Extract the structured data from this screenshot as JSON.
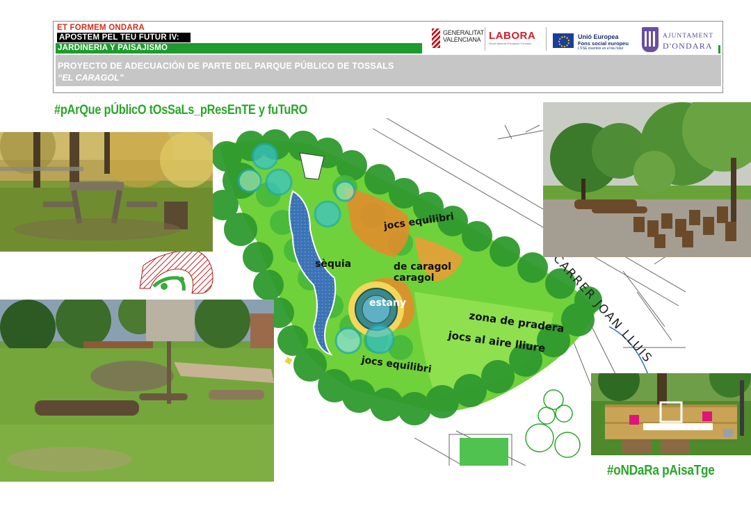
{
  "header": {
    "line1": "ET FORMEM ONDARA",
    "line2": "APOSTEM PEL TEU FUTUR IV:",
    "line3": "JARDINERIA Y PAISAJISMO",
    "project": "PROYECTO DE ADECUACIÓN DE PARTE DEL PARQUE PÚBLICO DE TOSSALS",
    "subtitle": "“EL CARAGOL”"
  },
  "logos": {
    "generalitat_line1": "GENERALITAT",
    "generalitat_line2": "VALENCIANA",
    "labora": "LABORA",
    "labora_sub": "Servei Valencià d'Ocupació i Formació",
    "eu_line1": "Unió Europea",
    "eu_line2": "Fons social europeu",
    "eu_line3": "L'FSE inverteix en el teu futur",
    "ajuntament_line1": "AJUNTAMENT",
    "ajuntament_line2": "D'ONDARA"
  },
  "hashtags": {
    "top": "#pArQue pÚblicO tOsSaLs_pResEnTE  y fuTuRO",
    "bottom": "#oNDaRa pAisaTge"
  },
  "plan": {
    "labels": {
      "jocs_top": "jocs equilibri",
      "sequia": "sèquia",
      "caragol_1": "de caragol",
      "caragol_2": "caragol",
      "estany": "estany",
      "zona_pradera": "zona de pradera",
      "jocs_aire": "jocs al aire lliure",
      "jocs_bottom": "jocs equilibri",
      "street": "CARRER JOAN LLUIS"
    }
  },
  "colors": {
    "header_red": "#d32f1a",
    "header_green": "#1e9b2e",
    "hashtag_green": "#2aa62a",
    "header_gray": "#c6c6c6"
  }
}
